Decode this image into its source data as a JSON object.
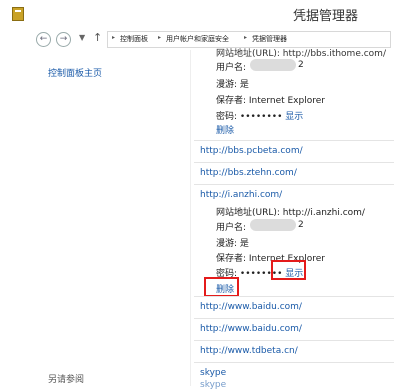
{
  "window": {
    "title": "凭据管理器"
  },
  "nav": {
    "back": "←",
    "forward": "→",
    "dropdown": "▼",
    "up": "↑"
  },
  "breadcrumb": [
    "控制面板",
    "用户帐户和家庭安全",
    "凭据管理器"
  ],
  "breadcrumb_sep": "▸",
  "left": {
    "home_link": "控制面板主页",
    "see_also": "另请参阅"
  },
  "top_entry": {
    "cut_text": "网站地址(URL): http://bbs.ithome.com/",
    "username_label": "用户名:",
    "username_suffix": "2",
    "roaming": "漫游: 是",
    "saved_by": "保存者: Internet Explorer",
    "password_label": "密码:",
    "password_dots": "••••••••",
    "show": "显示",
    "delete": "删除"
  },
  "entries_a": [
    "http://bbs.pcbeta.com/",
    "http://bbs.ztehn.com/",
    "http://i.anzhi.com/"
  ],
  "expanded": {
    "url": "网站地址(URL): http://i.anzhi.com/",
    "username_label": "用户名:",
    "username_suffix": "2",
    "roaming": "漫游: 是",
    "saved_by": "保存者: Internet Explorer",
    "password_label": "密码:",
    "password_dots": "••••••••",
    "show": "显示",
    "delete": "删除"
  },
  "entries_b": [
    "http://www.baidu.com/",
    "http://www.baidu.com/",
    "http://www.tdbeta.cn/",
    "skype"
  ],
  "bottom_cut": "skype",
  "colors": {
    "link": "#1a5aa8",
    "highlight": "#e41b1b"
  }
}
